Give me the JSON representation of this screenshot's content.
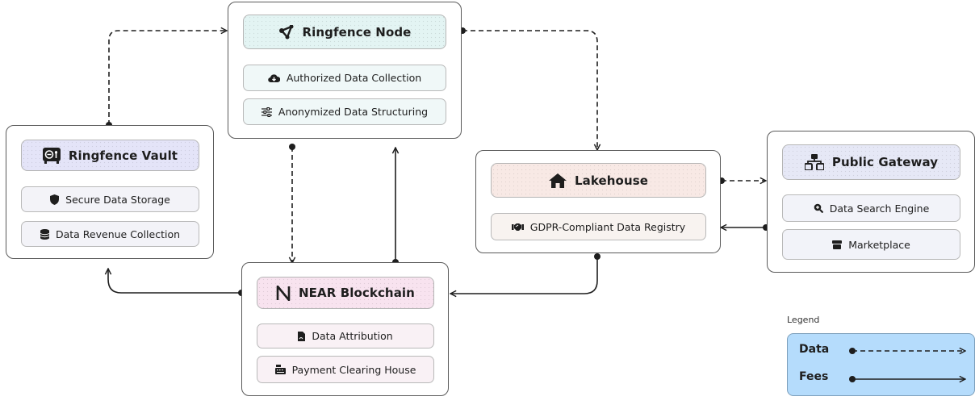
{
  "nodes": {
    "ringfence_node": {
      "title": "Ringfence Node",
      "title_icon": "share-nodes-icon",
      "items": [
        {
          "label": "Authorized Data Collection",
          "icon": "cloud-download-icon"
        },
        {
          "label": "Anonymized Data Structuring",
          "icon": "sliders-icon"
        }
      ]
    },
    "ringfence_vault": {
      "title": "Ringfence Vault",
      "title_icon": "vault-icon",
      "items": [
        {
          "label": "Secure Data Storage",
          "icon": "shield-icon"
        },
        {
          "label": "Data Revenue Collection",
          "icon": "database-icon"
        }
      ]
    },
    "lakehouse": {
      "title": "Lakehouse",
      "title_icon": "house-icon",
      "items": [
        {
          "label": "GDPR-Compliant Data Registry",
          "icon": "handshake-icon"
        }
      ]
    },
    "public_gateway": {
      "title": "Public Gateway",
      "title_icon": "sitemap-icon",
      "items": [
        {
          "label": "Data Search Engine",
          "icon": "search-plus-icon"
        },
        {
          "label": "Marketplace",
          "icon": "store-icon"
        }
      ]
    },
    "near_blockchain": {
      "title": "NEAR Blockchain",
      "title_icon": "near-logo-icon",
      "items": [
        {
          "label": "Data Attribution",
          "icon": "file-signature-icon"
        },
        {
          "label": "Payment Clearing House",
          "icon": "cash-register-icon"
        }
      ]
    }
  },
  "edges": [
    {
      "from": "Ringfence Vault",
      "to": "Ringfence Node",
      "kind": "Data"
    },
    {
      "from": "Ringfence Node",
      "to": "Lakehouse",
      "kind": "Data"
    },
    {
      "from": "Ringfence Node",
      "to": "NEAR Blockchain",
      "kind": "Data"
    },
    {
      "from": "NEAR Blockchain",
      "to": "Ringfence Node",
      "kind": "Fees"
    },
    {
      "from": "NEAR Blockchain",
      "to": "Ringfence Vault",
      "kind": "Fees"
    },
    {
      "from": "Lakehouse",
      "to": "NEAR Blockchain",
      "kind": "Fees"
    },
    {
      "from": "Lakehouse",
      "to": "Public Gateway",
      "kind": "Data"
    },
    {
      "from": "Public Gateway",
      "to": "Lakehouse",
      "kind": "Fees"
    }
  ],
  "legend": {
    "title": "Legend",
    "entries": [
      {
        "label": "Data",
        "style": "dashed"
      },
      {
        "label": "Fees",
        "style": "solid"
      }
    ]
  },
  "colors": {
    "node_header": "#e3f4f3",
    "vault_header": "#e4e4f8",
    "lakehouse_header": "#f8e9e5",
    "gateway_header": "#e6e8f6",
    "near_header": "#f8e3ef",
    "legend_bg": "#b5dcfc",
    "stroke": "#1e1e1e"
  }
}
